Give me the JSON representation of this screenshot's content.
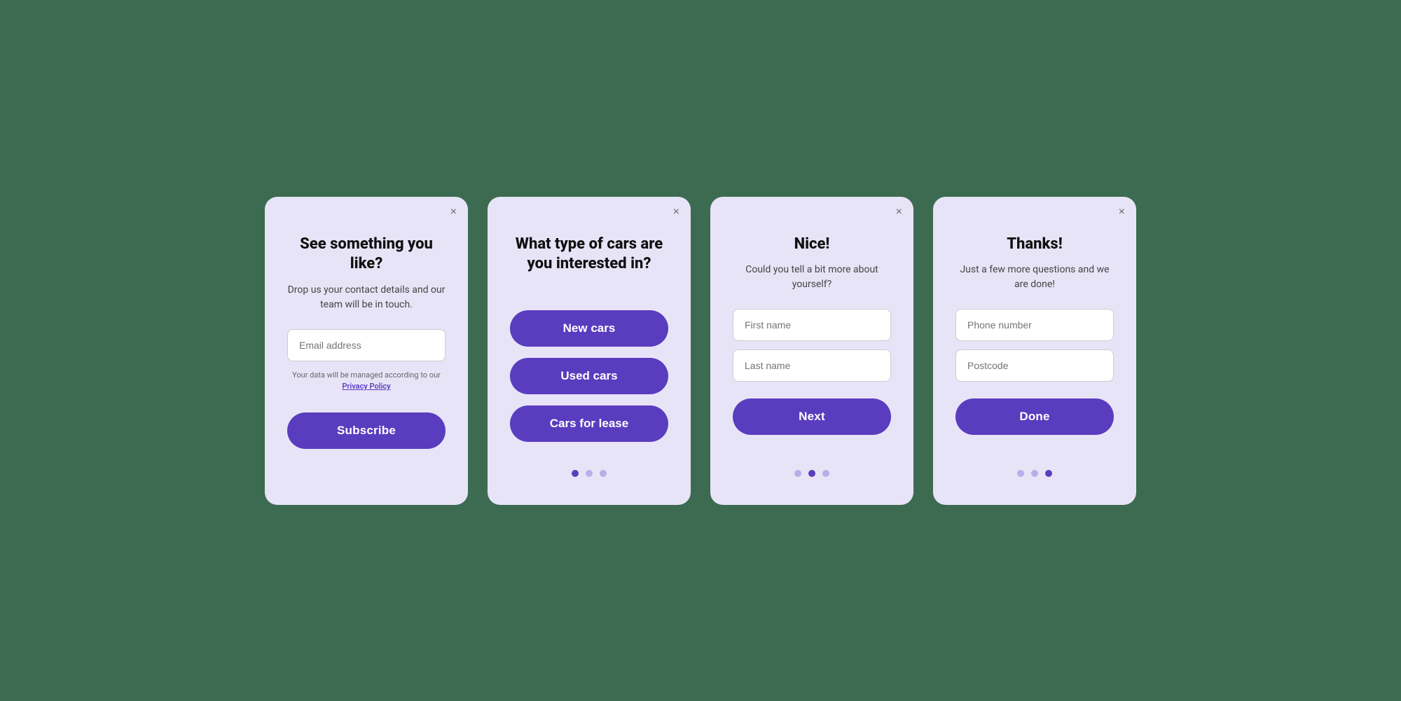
{
  "card1": {
    "title": "See something you like?",
    "subtitle": "Drop us your contact details and our team will be in touch.",
    "email_placeholder": "Email address",
    "privacy_text": "Your data will be managed according to our",
    "privacy_link": "Privacy Policy",
    "subscribe_label": "Subscribe",
    "close_icon": "×"
  },
  "card2": {
    "title": "What type of cars are you interested in?",
    "btn1": "New cars",
    "btn2": "Used cars",
    "btn3": "Cars for lease",
    "close_icon": "×",
    "dots": [
      {
        "active": true
      },
      {
        "active": false
      },
      {
        "active": false
      }
    ]
  },
  "card3": {
    "title": "Nice!",
    "subtitle": "Could you tell a bit more about yourself?",
    "first_name_placeholder": "First name",
    "last_name_placeholder": "Last name",
    "next_label": "Next",
    "close_icon": "×",
    "dots": [
      {
        "active": false
      },
      {
        "active": true
      },
      {
        "active": false
      }
    ]
  },
  "card4": {
    "title": "Thanks!",
    "subtitle": "Just a few more questions and we are done!",
    "phone_placeholder": "Phone number",
    "postcode_placeholder": "Postcode",
    "done_label": "Done",
    "close_icon": "×",
    "dots": [
      {
        "active": false
      },
      {
        "active": false
      },
      {
        "active": true
      }
    ]
  }
}
